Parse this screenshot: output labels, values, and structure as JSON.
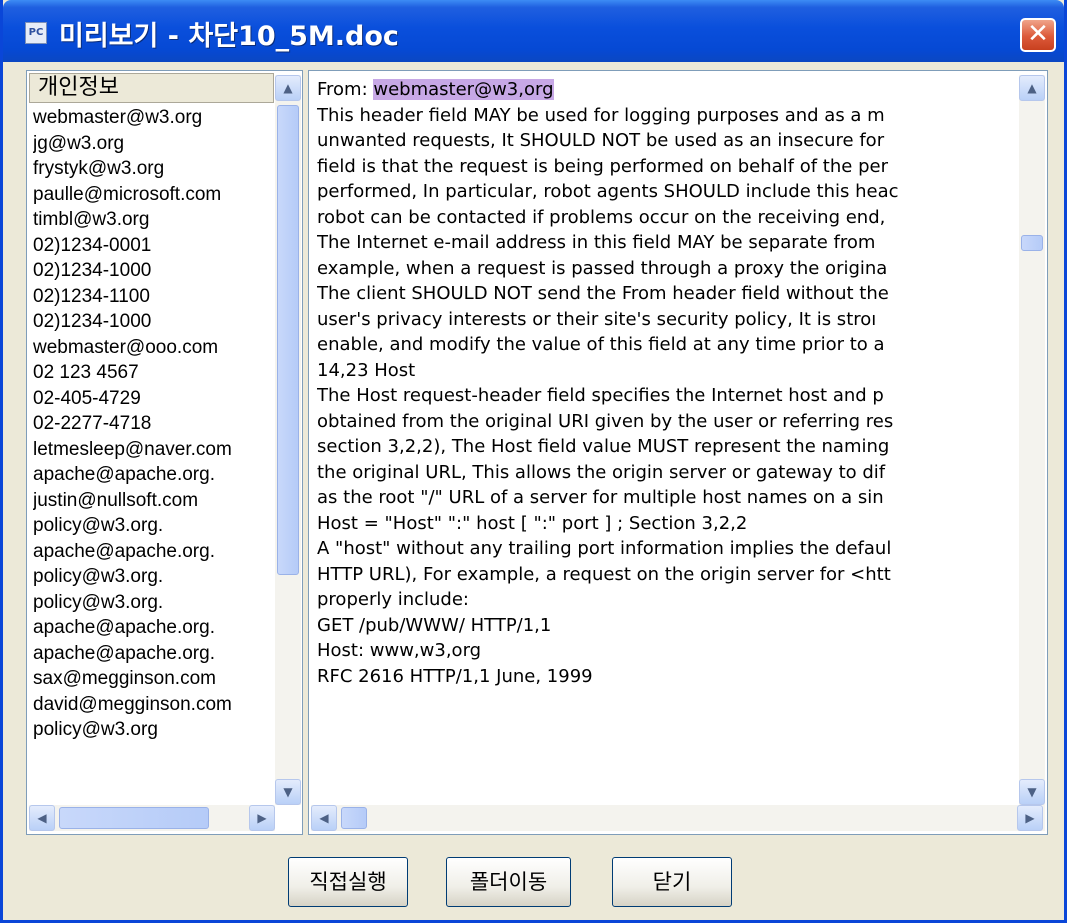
{
  "window": {
    "title": "미리보기 - 차단10_5M.doc",
    "app_icon": "PC",
    "close_symbol": "✕"
  },
  "left_panel": {
    "header": "개인정보",
    "items": [
      "webmaster@w3.org",
      "jg@w3.org",
      "frystyk@w3.org",
      "paulle@microsoft.com",
      "timbl@w3.org",
      "02)1234-0001",
      "02)1234-1000",
      "02)1234-1100",
      "02)1234-1000",
      "webmaster@ooo.com",
      "02 123 4567",
      "02-405-4729",
      "02-2277-4718",
      "letmesleep@naver.com",
      "apache@apache.org.",
      "justin@nullsoft.com",
      "policy@w3.org.",
      "apache@apache.org.",
      "policy@w3.org.",
      "policy@w3.org.",
      "apache@apache.org.",
      "apache@apache.org.",
      "sax@megginson.com",
      "david@megginson.com",
      "policy@w3.org"
    ]
  },
  "document": {
    "from_label": "From: ",
    "from_value": "webmaster@w3,org",
    "lines": [
      "This header field MAY be used for logging purposes and as a m",
      "unwanted requests, It SHOULD NOT be used as an insecure for",
      "field is that the request is being performed on behalf of the per",
      "performed, In particular, robot agents SHOULD include this heac",
      "robot can be contacted if problems occur on the receiving end,",
      "The Internet e-mail address in this field MAY be separate from",
      "example, when a request is passed through a proxy the origina",
      "The client SHOULD NOT send the From header field without the",
      "user's privacy interests or their site's security policy, It is stroı",
      "enable, and modify the value of this field at any time prior to a",
      "14,23 Host",
      "The Host request-header field specifies the Internet host and p",
      "obtained from the original URI given by the user or referring res",
      "section 3,2,2), The Host field value MUST represent the naming",
      "the original URL, This allows the origin server or gateway to dif",
      "as the root \"/\" URL of a server for multiple host names on a sin",
      "Host = \"Host\" \":\" host [ \":\" port ] ; Section 3,2,2",
      "A \"host\" without any trailing port information implies the defaul",
      "HTTP URL), For example, a request on the origin server for <htt",
      "properly include:",
      "GET /pub/WWW/ HTTP/1,1",
      "Host: www,w3,org",
      "RFC 2616 HTTP/1,1 June, 1999"
    ]
  },
  "buttons": {
    "execute": "직접실행",
    "move_folder": "폴더이동",
    "close": "닫기"
  },
  "icons": {
    "up": "up-arrow-icon",
    "down": "down-arrow-icon",
    "left": "left-arrow-icon",
    "right": "right-arrow-icon"
  },
  "colors": {
    "title_bar": "#0a4fdc",
    "highlight": "#c7a8e6",
    "window_bg": "#ece9d8"
  }
}
